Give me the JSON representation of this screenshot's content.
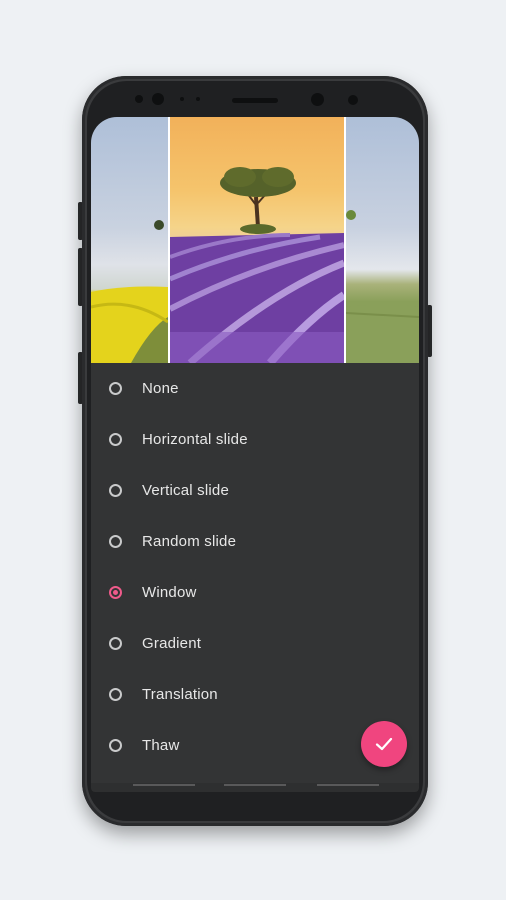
{
  "options": {
    "items": [
      {
        "label": "None",
        "selected": false
      },
      {
        "label": "Horizontal slide",
        "selected": false
      },
      {
        "label": "Vertical slide",
        "selected": false
      },
      {
        "label": "Random slide",
        "selected": false
      },
      {
        "label": "Window",
        "selected": true
      },
      {
        "label": "Gradient",
        "selected": false
      },
      {
        "label": "Translation",
        "selected": false
      },
      {
        "label": "Thaw",
        "selected": false
      }
    ]
  },
  "confirm": {
    "icon": "check-icon"
  },
  "colors": {
    "accent": "#f0457f",
    "panel": "#333435",
    "background": "#eef1f4"
  }
}
